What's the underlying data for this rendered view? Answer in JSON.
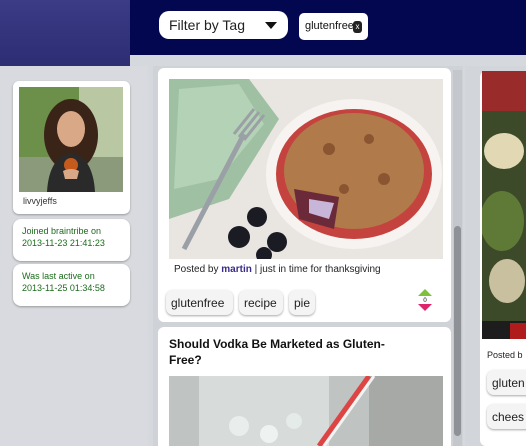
{
  "header": {
    "filter_label": "Filter by Tag",
    "active_tag": "glutenfree",
    "remove_tag_glyph": "x"
  },
  "profile": {
    "username": "livvyjeffs",
    "joined_label": "Joined braintribe on",
    "joined_date": "2013-11-23 21:41:23",
    "last_active_label": "Was last active on",
    "last_active_date": "2013-11-25 01:34:58"
  },
  "posts": [
    {
      "posted_by_label": "Posted by",
      "author": "martin",
      "caption": "| just in time for thanksgiving",
      "tags": [
        "glutenfree",
        "recipe",
        "pie"
      ],
      "score": "0"
    },
    {
      "title": "Should Vodka Be Marketed as Gluten-Free?"
    }
  ],
  "right_column": {
    "posted_by_label": "Posted b",
    "tags": [
      "gluten",
      "chees"
    ]
  },
  "colors": {
    "header_bg": "#020750",
    "author_link": "#3a2a8a",
    "profile_text": "#1c6b1c",
    "vote_up": "#7ec13a",
    "vote_down": "#e0246c"
  }
}
